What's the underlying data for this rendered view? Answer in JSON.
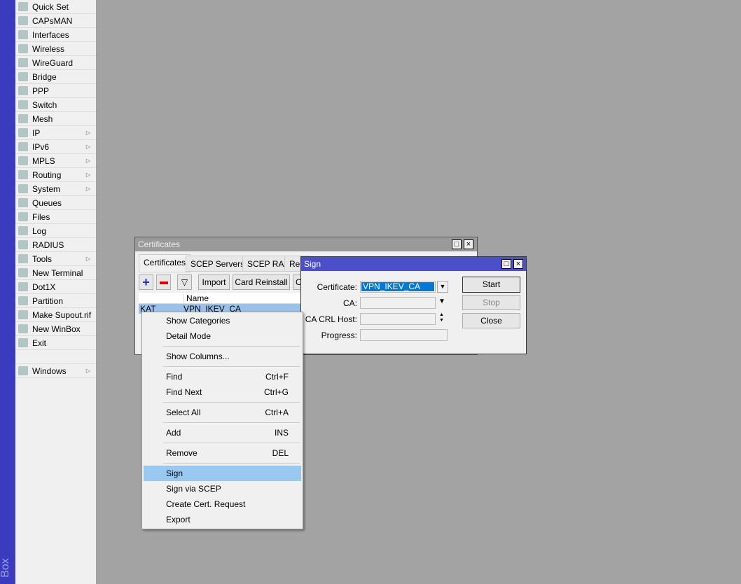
{
  "sidebar": {
    "brand": "Box",
    "items": [
      {
        "label": "Quick Set",
        "icon": "wand-icon",
        "sub": false
      },
      {
        "label": "CAPsMAN",
        "icon": "antenna-icon",
        "sub": false
      },
      {
        "label": "Interfaces",
        "icon": "interfaces-icon",
        "sub": false
      },
      {
        "label": "Wireless",
        "icon": "antenna-icon",
        "sub": false
      },
      {
        "label": "WireGuard",
        "icon": "wireguard-icon",
        "sub": false
      },
      {
        "label": "Bridge",
        "icon": "bridge-icon",
        "sub": false
      },
      {
        "label": "PPP",
        "icon": "ppp-icon",
        "sub": false
      },
      {
        "label": "Switch",
        "icon": "switch-icon",
        "sub": false
      },
      {
        "label": "Mesh",
        "icon": "mesh-icon",
        "sub": false
      },
      {
        "label": "IP",
        "icon": "ip-icon",
        "sub": true
      },
      {
        "label": "IPv6",
        "icon": "ipv6-icon",
        "sub": true
      },
      {
        "label": "MPLS",
        "icon": "mpls-icon",
        "sub": true
      },
      {
        "label": "Routing",
        "icon": "routing-icon",
        "sub": true
      },
      {
        "label": "System",
        "icon": "gear-icon",
        "sub": true
      },
      {
        "label": "Queues",
        "icon": "queues-icon",
        "sub": false
      },
      {
        "label": "Files",
        "icon": "folder-icon",
        "sub": false
      },
      {
        "label": "Log",
        "icon": "log-icon",
        "sub": false
      },
      {
        "label": "RADIUS",
        "icon": "radius-icon",
        "sub": false
      },
      {
        "label": "Tools",
        "icon": "tools-icon",
        "sub": true
      },
      {
        "label": "New Terminal",
        "icon": "terminal-icon",
        "sub": false
      },
      {
        "label": "Dot1X",
        "icon": "dot1x-icon",
        "sub": false
      },
      {
        "label": "Partition",
        "icon": "partition-icon",
        "sub": false
      },
      {
        "label": "Make Supout.rif",
        "icon": "supout-icon",
        "sub": false
      },
      {
        "label": "New WinBox",
        "icon": "winbox-icon",
        "sub": false
      },
      {
        "label": "Exit",
        "icon": "exit-icon",
        "sub": false
      }
    ],
    "windows": {
      "label": "Windows",
      "icon": "windows-icon"
    }
  },
  "certificates": {
    "title": "Certificates",
    "tabs": [
      "Certificates",
      "SCEP Servers",
      "SCEP RA",
      "Req"
    ],
    "toolbar": {
      "import": "Import",
      "card_reinstall": "Card Reinstall",
      "more": "C"
    },
    "columns": [
      "",
      "Name"
    ],
    "rows": [
      [
        "KAT",
        "VPN_IKEV_CA"
      ]
    ]
  },
  "sign": {
    "title": "Sign",
    "certificate_label": "Certificate:",
    "certificate_value": "VPN_IKEV_CA",
    "ca_label": "CA:",
    "ca_value": "",
    "crl_label": "CA CRL Host:",
    "crl_value": "",
    "progress_label": "Progress:",
    "progress": 0,
    "start": "Start",
    "stop": "Stop",
    "close": "Close"
  },
  "context_menu": {
    "items": [
      {
        "label": "Show Categories",
        "shortcut": ""
      },
      {
        "label": "Detail Mode",
        "shortcut": ""
      },
      {
        "label": "Show Columns...",
        "shortcut": ""
      },
      {
        "label": "Find",
        "shortcut": "Ctrl+F"
      },
      {
        "label": "Find Next",
        "shortcut": "Ctrl+G"
      },
      {
        "label": "Select All",
        "shortcut": "Ctrl+A"
      },
      {
        "label": "Add",
        "shortcut": "INS"
      },
      {
        "label": "Remove",
        "shortcut": "DEL"
      },
      {
        "label": "Sign",
        "shortcut": ""
      },
      {
        "label": "Sign via SCEP",
        "shortcut": ""
      },
      {
        "label": "Create Cert. Request",
        "shortcut": ""
      },
      {
        "label": "Export",
        "shortcut": ""
      }
    ],
    "highlighted": "Sign"
  },
  "colors": {
    "accent": "#4b4fc8",
    "highlight": "#99c9f3",
    "selection": "#0078d7"
  }
}
